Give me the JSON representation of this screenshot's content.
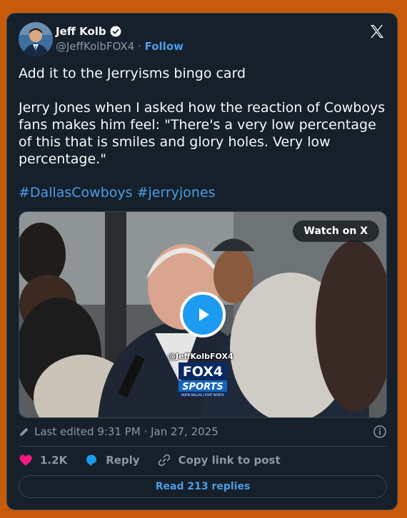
{
  "author": {
    "name": "Jeff Kolb",
    "handle": "@JeffKolbFOX4",
    "separator": "·",
    "follow_label": "Follow",
    "verified_icon": "verified-badge-icon"
  },
  "tweet": {
    "text": "Add it to the Jerryisms bingo card\n\nJerry Jones when I asked how the reaction of Cowboys fans makes him feel: \"There's a very low percentage of this that is smiles and glory holes. Very low percentage.\"",
    "hashtags": [
      "#DallasCowboys",
      "#jerryjones"
    ]
  },
  "media": {
    "watch_label": "Watch on X",
    "watermark_handle": "@JeffKolbFOX4",
    "logo_line1": "FOX4",
    "logo_line2": "SPORTS",
    "logo_sub": "KDFW DALLAS | FORT WORTH"
  },
  "meta": {
    "edited_text": "Last edited 9:31 PM · Jan 27, 2025"
  },
  "actions": {
    "likes": "1.2K",
    "reply_label": "Reply",
    "copy_label": "Copy link to post"
  },
  "read_replies": "Read 213 replies",
  "colors": {
    "background": "#c75a0b",
    "card": "#15202b",
    "accent": "#4d9ce6",
    "like": "#f91880",
    "reply": "#1d9bf0"
  }
}
